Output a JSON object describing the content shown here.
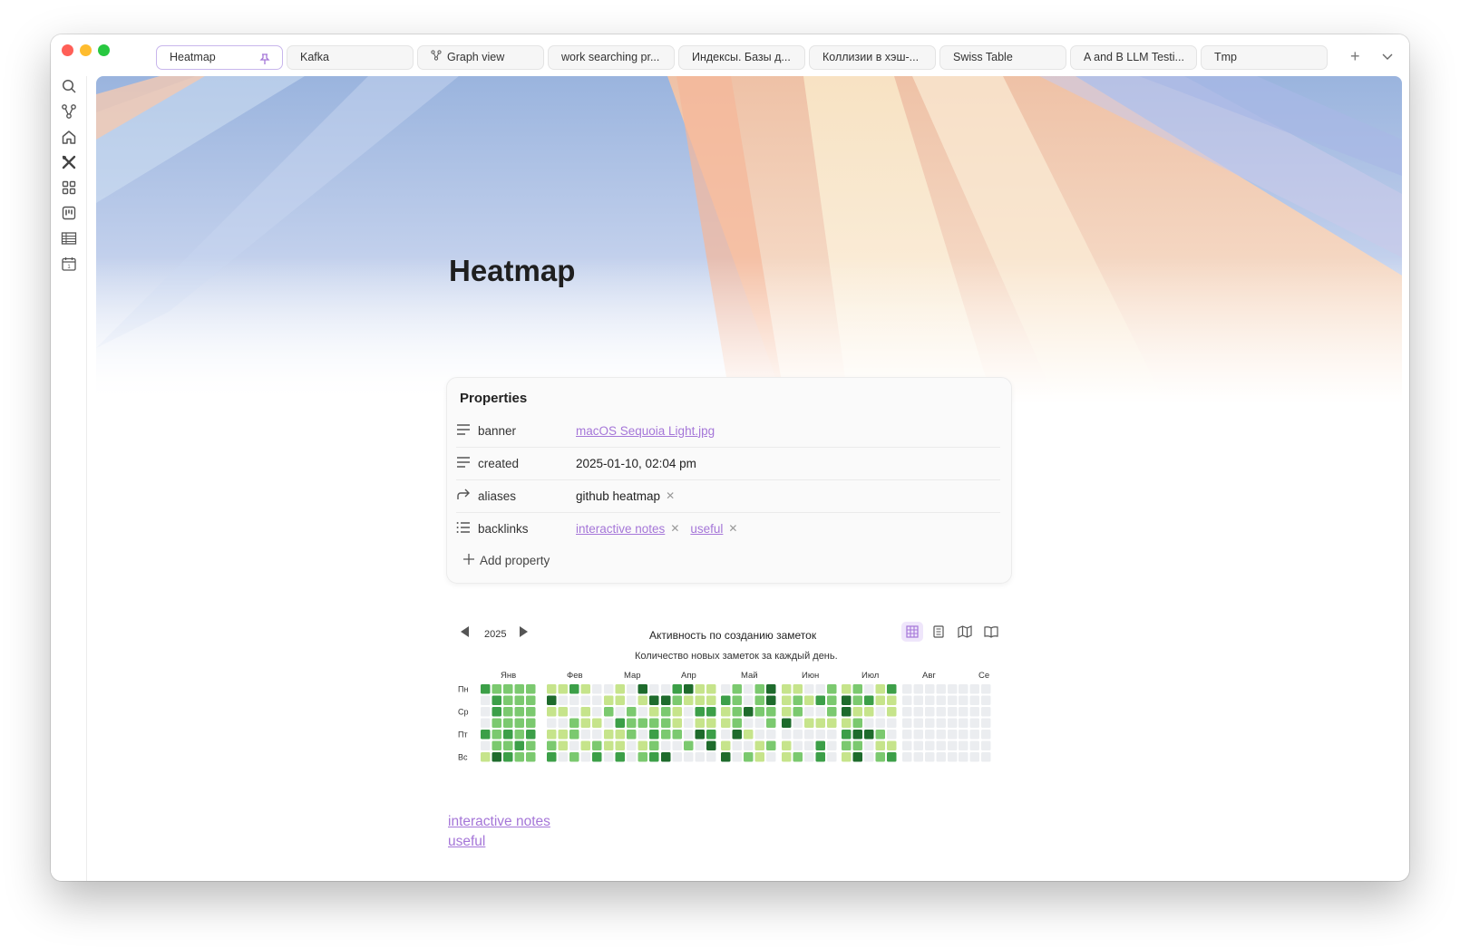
{
  "tabs": [
    {
      "label": "Heatmap",
      "active": true,
      "pinned": true
    },
    {
      "label": "Kafka"
    },
    {
      "label": "Graph view",
      "icon": "graph-icon"
    },
    {
      "label": "work searching pr..."
    },
    {
      "label": "Индексы. Базы д..."
    },
    {
      "label": "Коллизии в хэш-..."
    },
    {
      "label": "Swiss Table"
    },
    {
      "label": "A and B LLM Testi..."
    },
    {
      "label": "Tmp"
    }
  ],
  "sidebar": [
    "search-icon",
    "graph-icon",
    "home-icon",
    "tools-icon",
    "dashboard-icon",
    "kanban-icon",
    "table-icon",
    "calendar-icon"
  ],
  "page": {
    "title": "Heatmap"
  },
  "properties": {
    "title": "Properties",
    "rows": [
      {
        "key": "banner",
        "values": [
          "macOS Sequoia Light.jpg"
        ],
        "link": true
      },
      {
        "key": "created",
        "values": [
          "2025-01-10, 02:04 pm"
        ]
      },
      {
        "key": "aliases",
        "values": [
          "github heatmap"
        ],
        "removable": true
      },
      {
        "key": "backlinks",
        "values": [
          "interactive notes",
          "useful"
        ],
        "link": true,
        "removable": true
      }
    ],
    "add_label": "Add property"
  },
  "heatmap": {
    "year": "2025",
    "title": "Активность по созданию заметок",
    "subtitle": "Количество новых заметок за каждый день.",
    "weekday_labels": [
      "Пн",
      "",
      "Ср",
      "",
      "Пт",
      "",
      "Вс"
    ],
    "months": [
      "Янв",
      "Фев",
      "Мар",
      "Апр",
      "Май",
      "Июн",
      "Июл",
      "Авг",
      "Се"
    ],
    "colors": {
      "0": "#ebedf0",
      "1": "#c6e48b",
      "2": "#7bc96f",
      "3": "#3c9f48",
      "4": "#1e6b2c",
      "accent": "#a576d8"
    },
    "levels": [
      [
        0,
        0,
        0,
        0,
        0,
        0,
        0,
        0,
        0
      ],
      [
        0,
        0,
        0,
        0,
        0,
        0,
        0,
        0,
        0
      ],
      [
        0,
        0,
        0,
        0,
        0,
        0,
        0,
        0,
        0
      ],
      [
        0,
        0,
        0,
        0,
        0,
        0,
        0,
        0,
        0
      ]
    ]
  },
  "footer_links": [
    "interactive notes",
    "useful"
  ]
}
